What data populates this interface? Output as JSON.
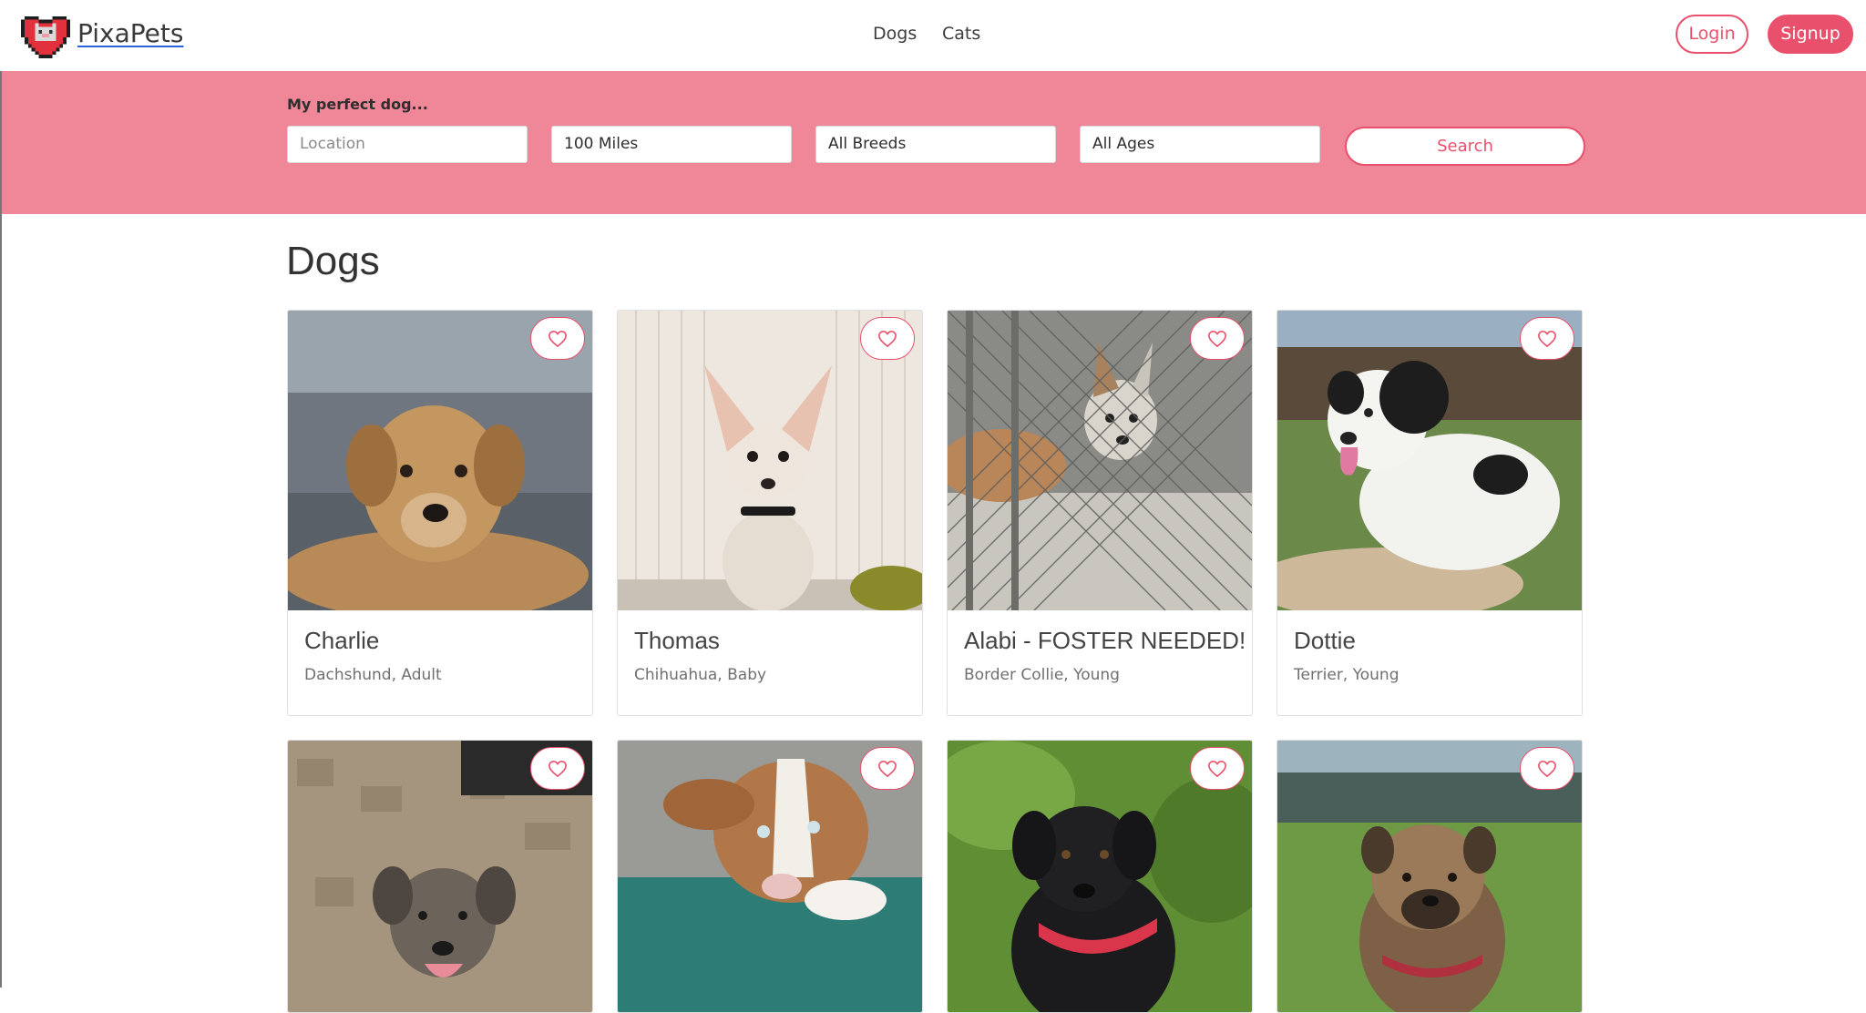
{
  "brand": {
    "name": "PixaPets",
    "logo_icon": "pixel-heart-cat-logo"
  },
  "nav": {
    "links": [
      "Dogs",
      "Cats"
    ]
  },
  "auth": {
    "login_label": "Login",
    "signup_label": "Signup"
  },
  "colors": {
    "accent": "#e8506c",
    "band": "#f08798"
  },
  "search": {
    "title": "My perfect dog...",
    "location_placeholder": "Location",
    "distance": "100 Miles",
    "breed": "All Breeds",
    "age": "All Ages",
    "button_label": "Search"
  },
  "section_title": "Dogs",
  "pets": [
    {
      "name": "Charlie",
      "meta": "Dachshund, Adult",
      "favorite_icon": "heart-outline-icon"
    },
    {
      "name": "Thomas",
      "meta": "Chihuahua, Baby",
      "favorite_icon": "heart-outline-icon"
    },
    {
      "name": "Alabi - FOSTER NEEDED!",
      "meta": "Border Collie, Young",
      "favorite_icon": "heart-outline-icon"
    },
    {
      "name": "Dottie",
      "meta": "Terrier, Young",
      "favorite_icon": "heart-outline-icon"
    },
    {
      "name": "",
      "meta": "",
      "favorite_icon": "heart-outline-icon"
    },
    {
      "name": "",
      "meta": "",
      "favorite_icon": "heart-outline-icon"
    },
    {
      "name": "",
      "meta": "",
      "favorite_icon": "heart-outline-icon"
    },
    {
      "name": "",
      "meta": "",
      "favorite_icon": "heart-outline-icon"
    }
  ]
}
